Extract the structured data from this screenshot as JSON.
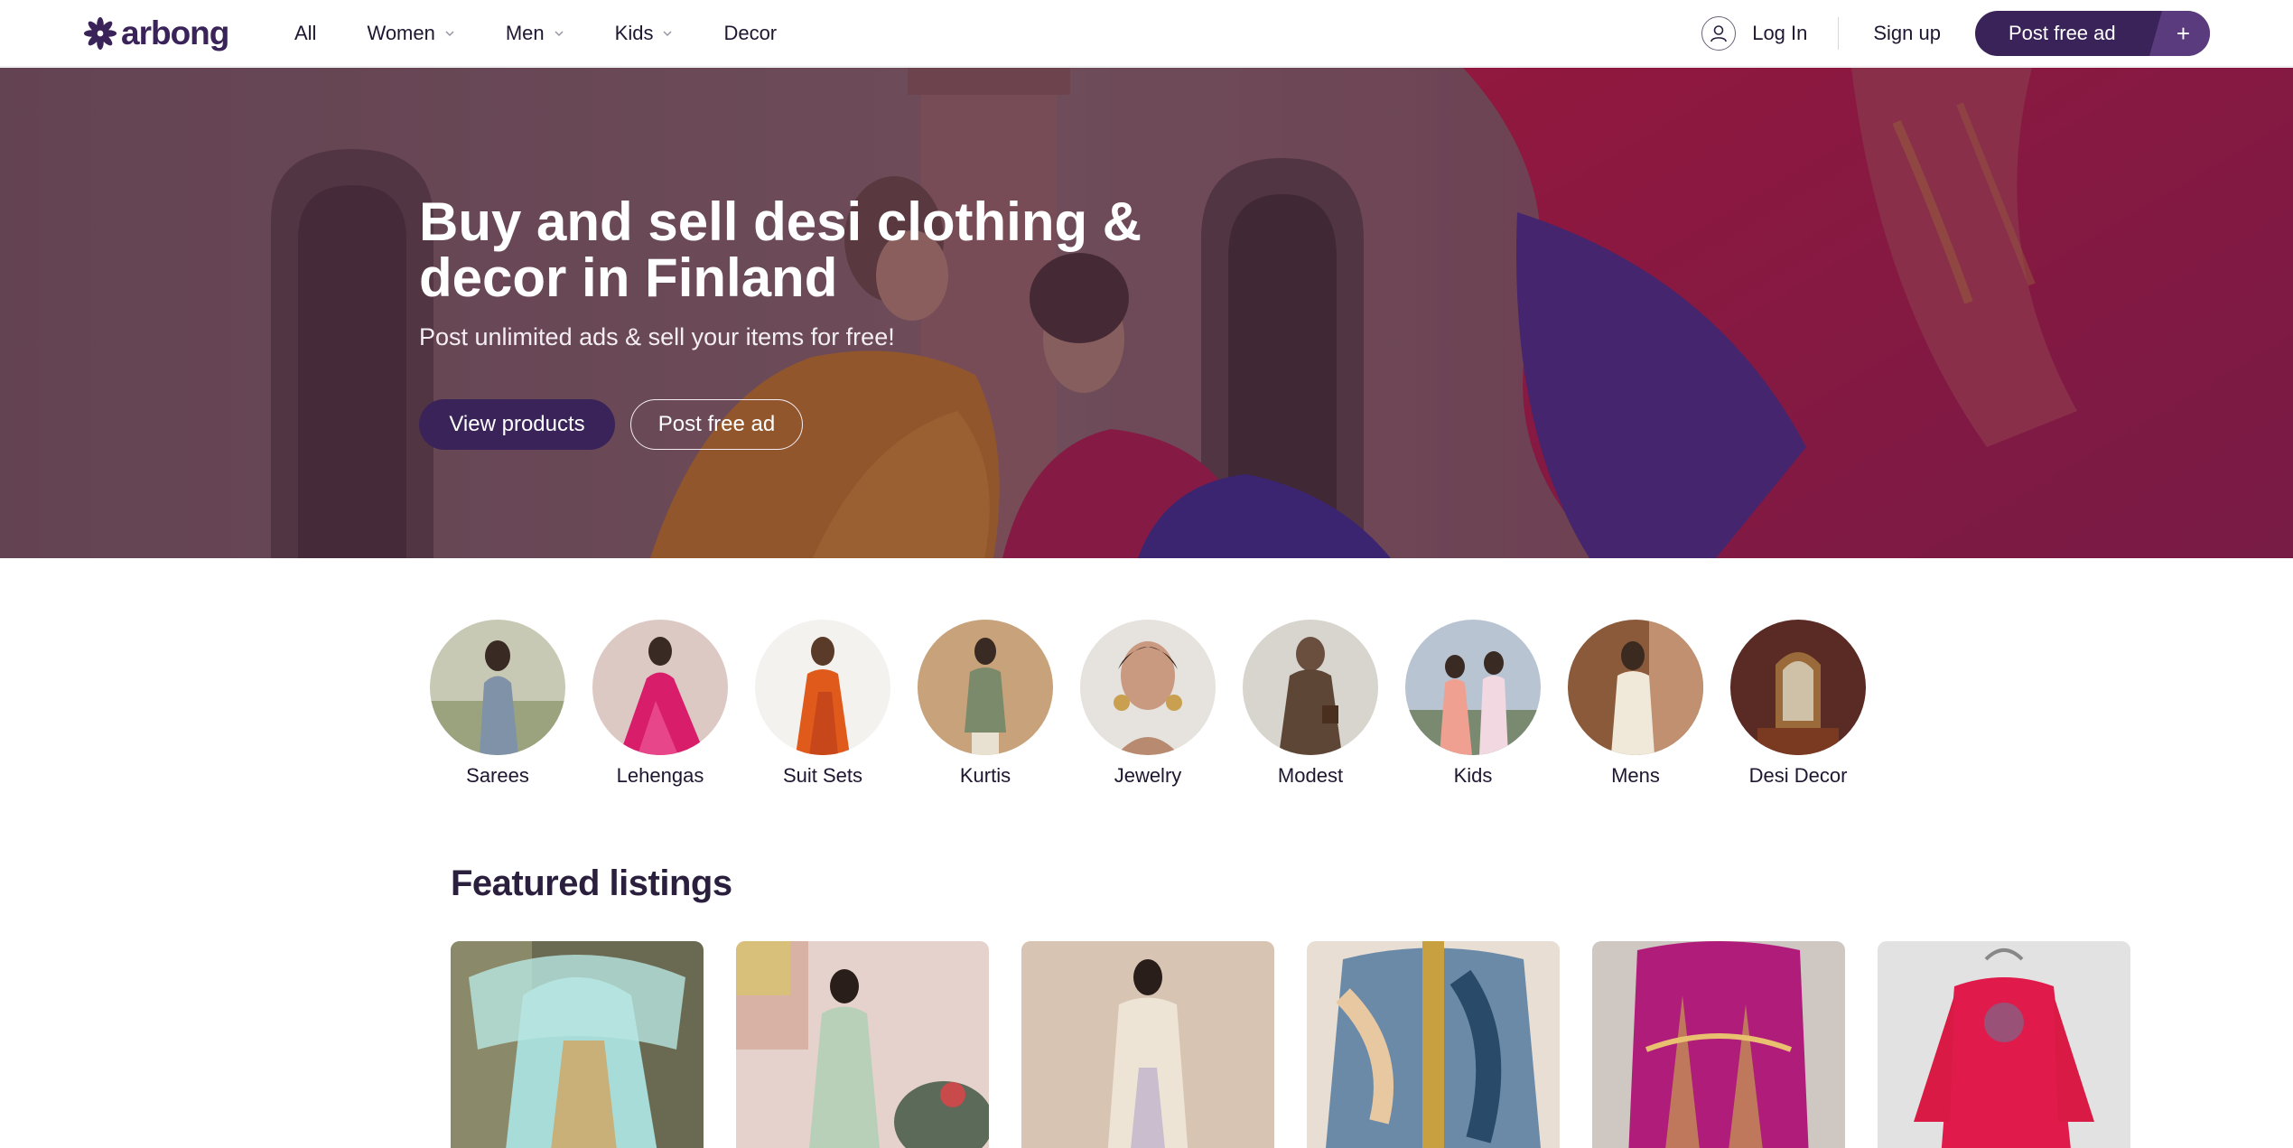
{
  "header": {
    "logo_text": "arbong",
    "nav": [
      {
        "label": "All",
        "has_dropdown": false
      },
      {
        "label": "Women",
        "has_dropdown": true
      },
      {
        "label": "Men",
        "has_dropdown": true
      },
      {
        "label": "Kids",
        "has_dropdown": true
      },
      {
        "label": "Decor",
        "has_dropdown": false
      }
    ],
    "login_label": "Log In",
    "signup_label": "Sign up",
    "post_ad_label": "Post free ad",
    "post_ad_plus": "+"
  },
  "hero": {
    "title": "Buy and sell desi clothing & decor in Finland",
    "subtitle": "Post unlimited ads & sell your items for free!",
    "primary_button": "View products",
    "secondary_button": "Post free ad"
  },
  "categories": [
    {
      "label": "Sarees"
    },
    {
      "label": "Lehengas"
    },
    {
      "label": "Suit Sets"
    },
    {
      "label": "Kurtis"
    },
    {
      "label": "Jewelry"
    },
    {
      "label": "Modest"
    },
    {
      "label": "Kids"
    },
    {
      "label": "Mens"
    },
    {
      "label": "Desi Decor"
    }
  ],
  "featured": {
    "title": "Featured listings",
    "listing_count": 6
  },
  "colors": {
    "brand": "#3a2358",
    "brand_light": "#5a3c7e",
    "text": "#1f1630"
  }
}
